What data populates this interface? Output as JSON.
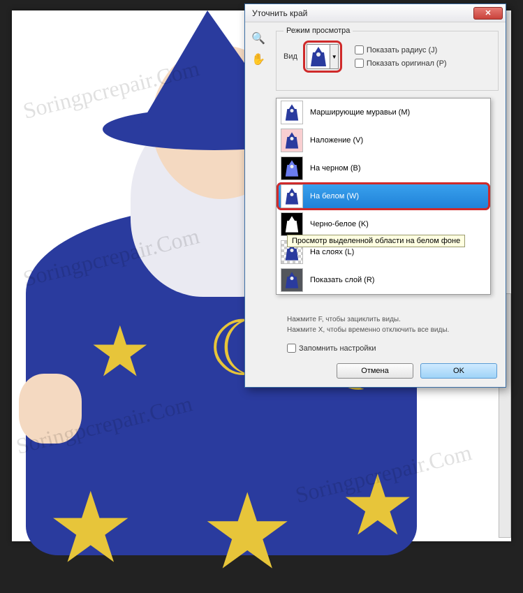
{
  "watermark": "Soringpcrepair.Com",
  "dialog": {
    "title": "Уточнить край",
    "fieldset_label": "Режим просмотра",
    "view_label": "Вид",
    "show_radius": "Показать радиус (J)",
    "show_original": "Показать оригинал (P)",
    "hint1": "Нажмите F, чтобы зациклить виды.",
    "hint2": "Нажмите X, чтобы временно отключить все виды.",
    "remember": "Запомнить настройки",
    "ok": "OK",
    "cancel": "Отмена"
  },
  "tooltip": "Просмотр выделенной области на белом фоне",
  "view_options": [
    {
      "label": "Марширующие муравьи (M)",
      "thumb": "white"
    },
    {
      "label": "Наложение (V)",
      "thumb": "pink"
    },
    {
      "label": "На черном (B)",
      "thumb": "black"
    },
    {
      "label": "На белом (W)",
      "thumb": "white",
      "selected": true
    },
    {
      "label": "Черно-белое (K)",
      "thumb": "bw"
    },
    {
      "label": "На слоях (L)",
      "thumb": "check"
    },
    {
      "label": "Показать слой (R)",
      "thumb": "layer"
    }
  ]
}
